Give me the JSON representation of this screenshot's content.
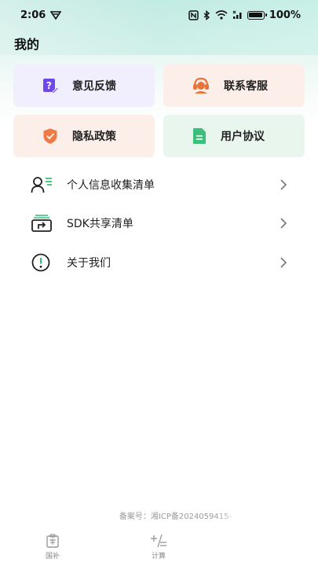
{
  "status_bar": {
    "time": "2:06",
    "battery": "100%"
  },
  "page": {
    "title": "我的"
  },
  "tiles": {
    "feedback": "意见反馈",
    "service": "联系客服",
    "privacy": "隐私政策",
    "agreement": "用户协议"
  },
  "list": {
    "personal_info": "个人信息收集清单",
    "sdk_share": "SDK共享清单",
    "about": "关于我们"
  },
  "footer": {
    "record": "备案号：湘ICP备2024059415-"
  },
  "tabs": {
    "guobu": "国补",
    "calc": "计算"
  },
  "colors": {
    "feedback_icon": "#7048e8",
    "service_icon": "#e8743b",
    "privacy_icon": "#ef7a45",
    "agreement_icon": "#3cbf7a",
    "tile_feedback_bg": "#f1eefd",
    "tile_warm_bg": "#fcefe9",
    "tile_green_bg": "#e8f6ee"
  }
}
